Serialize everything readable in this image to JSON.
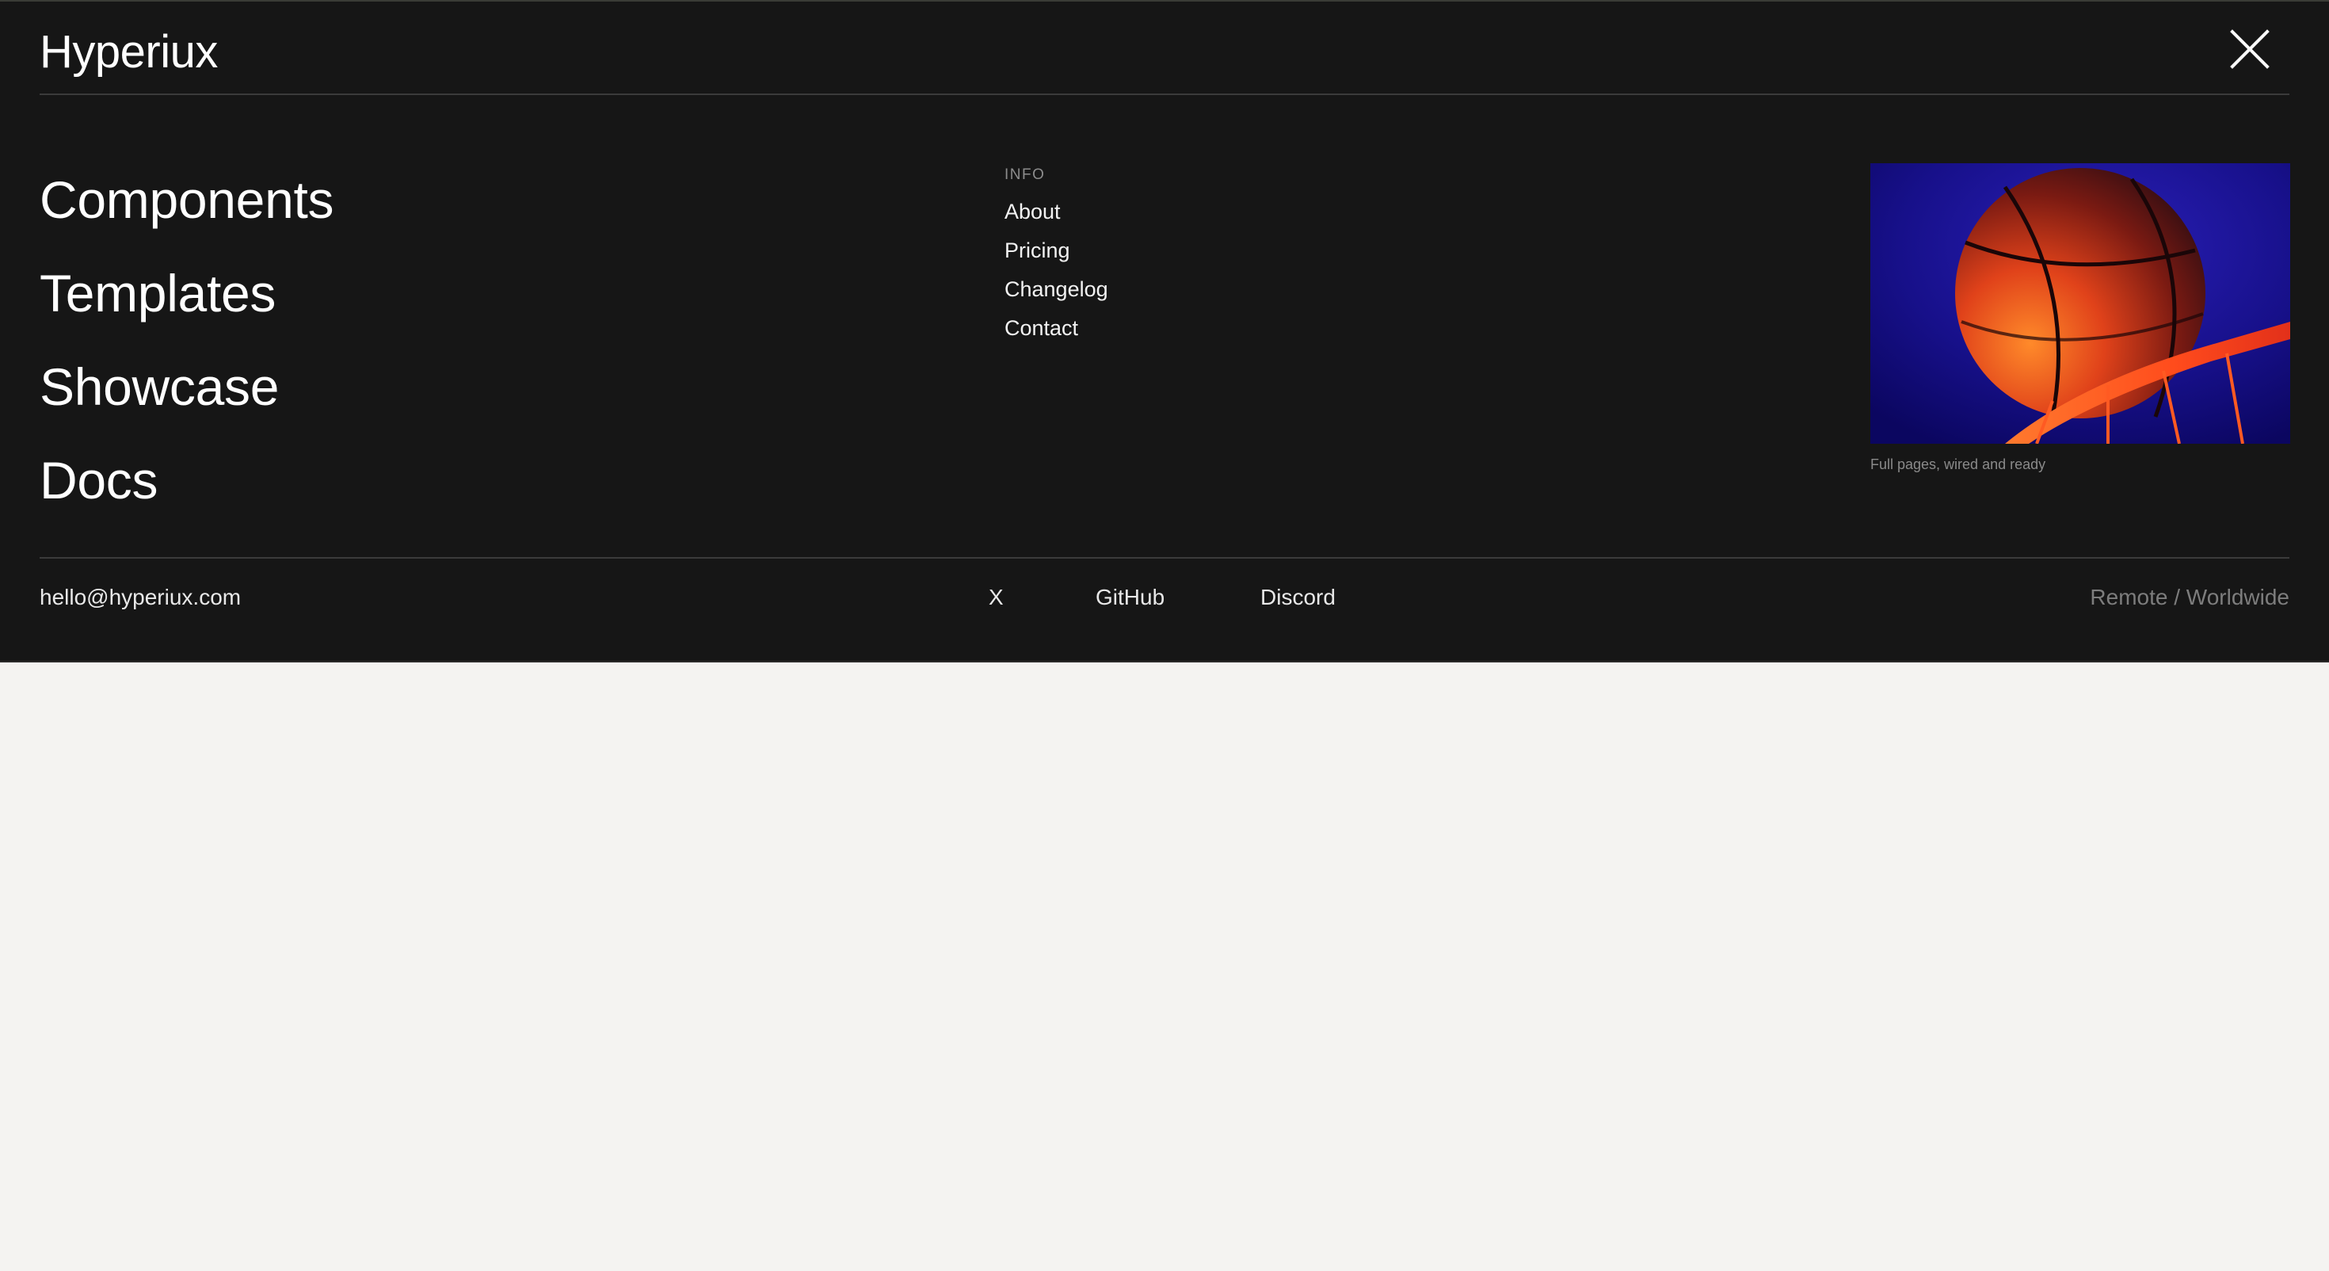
{
  "brand": {
    "name": "Hyperiux"
  },
  "header": {
    "close_icon": "close-icon"
  },
  "primary_nav": {
    "items": [
      {
        "label": "Components"
      },
      {
        "label": "Templates"
      },
      {
        "label": "Showcase"
      },
      {
        "label": "Docs"
      }
    ]
  },
  "info": {
    "heading": "INFO",
    "links": [
      {
        "label": "About"
      },
      {
        "label": "Pricing"
      },
      {
        "label": "Changelog"
      },
      {
        "label": "Contact"
      }
    ]
  },
  "feature": {
    "image_subject": "basketball-over-hoop",
    "caption": "Full pages, wired and ready"
  },
  "footer": {
    "email": "hello@hyperiux.com",
    "socials": [
      {
        "label": "X"
      },
      {
        "label": "GitHub"
      },
      {
        "label": "Discord"
      }
    ],
    "location": "Remote / Worldwide"
  },
  "colors": {
    "panel_background": "#161616",
    "page_background": "#f4f3f1",
    "primary_text": "#ffffff",
    "muted_text": "#8a8a8a",
    "divider": "#3b3b3b"
  }
}
